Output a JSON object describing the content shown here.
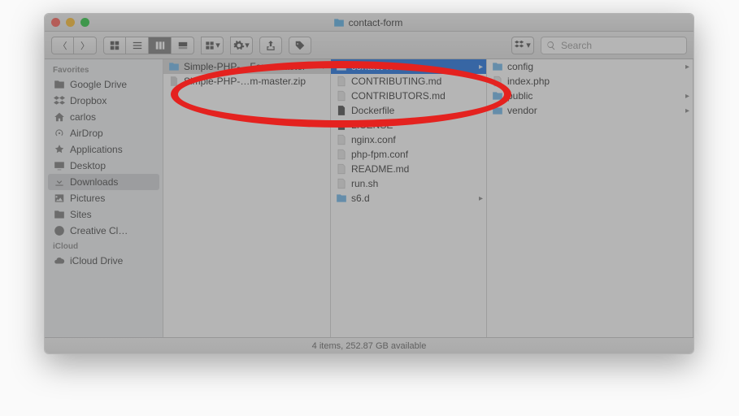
{
  "window": {
    "title": "contact-form"
  },
  "toolbar": {
    "dropbox_label": "",
    "search_placeholder": "Search"
  },
  "sidebar": {
    "sections": [
      {
        "label": "Favorites",
        "items": [
          {
            "label": "Google Drive",
            "icon": "folder",
            "selected": false
          },
          {
            "label": "Dropbox",
            "icon": "dropbox",
            "selected": false
          },
          {
            "label": "carlos",
            "icon": "home",
            "selected": false
          },
          {
            "label": "AirDrop",
            "icon": "airdrop",
            "selected": false
          },
          {
            "label": "Applications",
            "icon": "apps",
            "selected": false
          },
          {
            "label": "Desktop",
            "icon": "desktop",
            "selected": false
          },
          {
            "label": "Downloads",
            "icon": "downloads",
            "selected": true
          },
          {
            "label": "Pictures",
            "icon": "pictures",
            "selected": false
          },
          {
            "label": "Sites",
            "icon": "folder",
            "selected": false
          },
          {
            "label": "Creative Cl…",
            "icon": "cc",
            "selected": false
          }
        ]
      },
      {
        "label": "iCloud",
        "items": [
          {
            "label": "iCloud Drive",
            "icon": "icloud",
            "selected": false
          }
        ]
      }
    ]
  },
  "columns": {
    "c1": [
      {
        "label": "Simple-PHP-…Form-master",
        "type": "folder",
        "sel": "grey",
        "arrow": true
      },
      {
        "label": "Simple-PHP-…m-master.zip",
        "type": "zip",
        "sel": "none",
        "arrow": false
      }
    ],
    "c2": [
      {
        "label": "contact-form",
        "type": "folder",
        "sel": "blue",
        "arrow": true
      },
      {
        "label": "CONTRIBUTING.md",
        "type": "file",
        "sel": "none",
        "arrow": false
      },
      {
        "label": "CONTRIBUTORS.md",
        "type": "file",
        "sel": "none",
        "arrow": false
      },
      {
        "label": "Dockerfile",
        "type": "file-dark",
        "sel": "none",
        "arrow": false
      },
      {
        "label": "LICENSE",
        "type": "file-dark",
        "sel": "none",
        "arrow": false
      },
      {
        "label": "nginx.conf",
        "type": "file",
        "sel": "none",
        "arrow": false
      },
      {
        "label": "php-fpm.conf",
        "type": "file",
        "sel": "none",
        "arrow": false
      },
      {
        "label": "README.md",
        "type": "file",
        "sel": "none",
        "arrow": false
      },
      {
        "label": "run.sh",
        "type": "file",
        "sel": "none",
        "arrow": false
      },
      {
        "label": "s6.d",
        "type": "folder",
        "sel": "none",
        "arrow": true
      }
    ],
    "c3": [
      {
        "label": "config",
        "type": "folder",
        "sel": "none",
        "arrow": true
      },
      {
        "label": "index.php",
        "type": "file",
        "sel": "none",
        "arrow": false
      },
      {
        "label": "public",
        "type": "folder",
        "sel": "none",
        "arrow": true
      },
      {
        "label": "vendor",
        "type": "folder",
        "sel": "none",
        "arrow": true
      }
    ]
  },
  "status": {
    "text": "4 items, 252.87 GB available"
  }
}
